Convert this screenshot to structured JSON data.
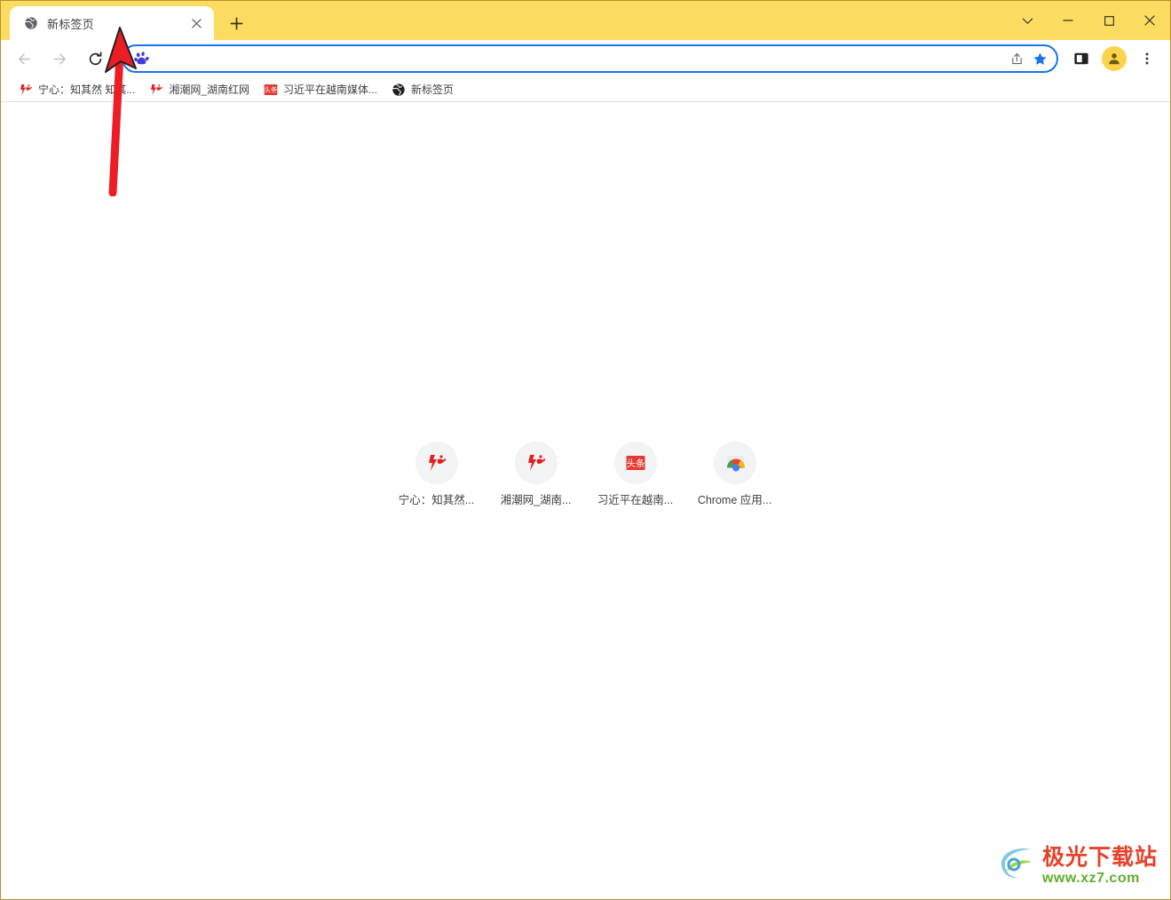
{
  "window": {
    "theme_color": "#fcdc60",
    "controls": [
      {
        "name": "tab-search",
        "icon": "chevron-down-icon",
        "label": "∨"
      },
      {
        "name": "minimize",
        "icon": "minimize-icon",
        "label": "—"
      },
      {
        "name": "maximize",
        "icon": "maximize-icon",
        "label": "□"
      },
      {
        "name": "close",
        "icon": "close-icon",
        "label": "×"
      }
    ]
  },
  "tabstrip": {
    "tabs": [
      {
        "title": "新标签页",
        "favicon": "globe-icon",
        "active": true,
        "close_label": "×"
      }
    ],
    "new_tab_label": "+"
  },
  "toolbar": {
    "back_label": "←",
    "forward_label": "→",
    "reload_label": "↻",
    "omnibox": {
      "value": "",
      "placeholder": "",
      "engine_icon": "baidu-paw-icon",
      "share_icon": "share-icon",
      "bookmark_icon": "star-filled-icon",
      "bookmark_color": "#1a73e8",
      "focused": true
    },
    "side_panel_icon": "side-panel-icon",
    "avatar_icon": "person-icon",
    "menu_icon": "three-dot-menu-icon",
    "menu_label": "⋮"
  },
  "bookmarks_bar": {
    "items": [
      {
        "label": "宁心：知其然 知其...",
        "favicon": "red-flame-icon"
      },
      {
        "label": "湘潮网_湖南红网",
        "favicon": "red-flame-icon"
      },
      {
        "label": "习近平在越南媒体...",
        "favicon": "toutiao-icon"
      },
      {
        "label": "新标签页",
        "favicon": "globe-icon"
      }
    ]
  },
  "new_tab_page": {
    "shortcuts": [
      {
        "label": "宁心：知其然...",
        "icon": "red-flame-icon"
      },
      {
        "label": "湘潮网_湖南...",
        "icon": "red-flame-icon"
      },
      {
        "label": "习近平在越南...",
        "icon": "toutiao-icon"
      },
      {
        "label": "Chrome 应用...",
        "icon": "chrome-apps-icon"
      }
    ]
  },
  "annotation": {
    "arrow_color": "#ee1c25",
    "description": "red-arrow-pointing-to-tab"
  },
  "watermark": {
    "title": "极光下载站",
    "url": "www.xz7.com",
    "title_color": "#e8412a",
    "url_color": "#5fae2e"
  }
}
